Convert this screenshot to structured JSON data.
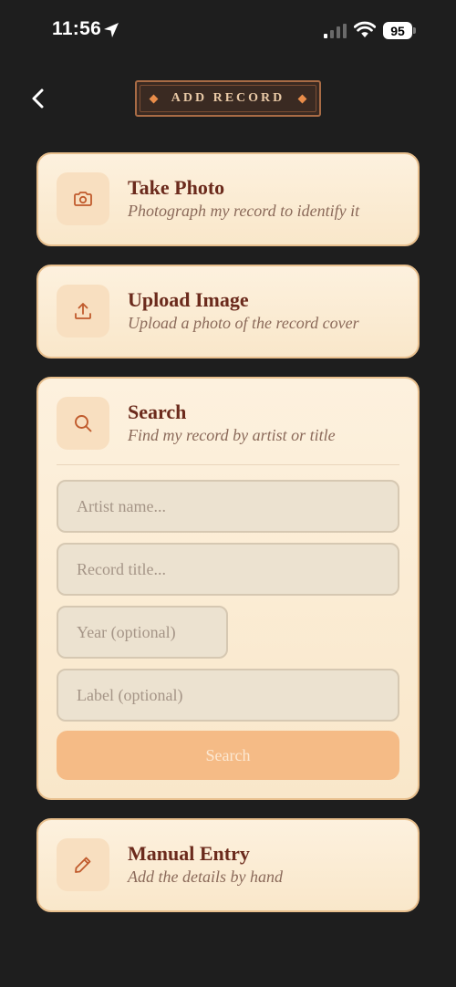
{
  "status_bar": {
    "time": "11:56",
    "battery": "95",
    "icons": [
      "location-arrow-icon",
      "signal-icon",
      "wifi-icon",
      "battery-icon"
    ]
  },
  "header": {
    "title": "ADD RECORD",
    "back_icon": "chevron-left-icon"
  },
  "options": {
    "take_photo": {
      "title": "Take Photo",
      "subtitle": "Photograph my record to identify it",
      "icon": "camera-icon"
    },
    "upload_image": {
      "title": "Upload Image",
      "subtitle": "Upload a photo of the record cover",
      "icon": "upload-icon"
    },
    "search": {
      "title": "Search",
      "subtitle": "Find my record by artist or title",
      "icon": "search-icon",
      "artist_placeholder": "Artist name...",
      "title_placeholder": "Record title...",
      "year_placeholder": "Year (optional)",
      "label_placeholder": "Label (optional)",
      "button_label": "Search"
    },
    "manual_entry": {
      "title": "Manual Entry",
      "subtitle": "Add the details by hand",
      "icon": "pencil-icon"
    }
  },
  "colors": {
    "background": "#1e1e1e",
    "card": "#fdf1de",
    "card_border": "#e8bf8d",
    "accent": "#e98d4a",
    "title_text": "#6b2a1c",
    "button": "#f5bb86"
  }
}
